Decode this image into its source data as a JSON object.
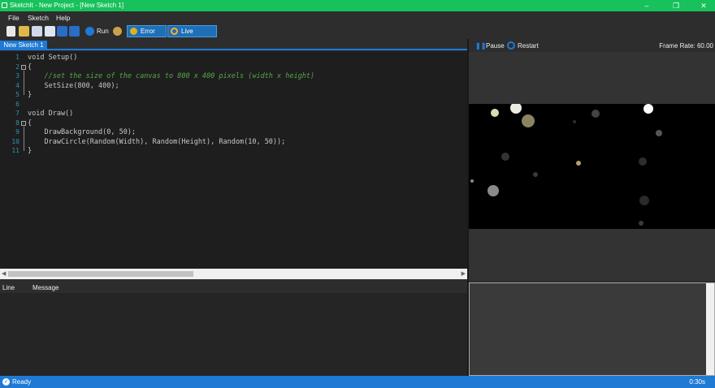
{
  "window": {
    "title": "SketchIt - New Project - [New Sketch 1]",
    "minimize": "–",
    "maximize": "❐",
    "close": "✕"
  },
  "menu": {
    "file": "File",
    "sketch": "Sketch",
    "help": "Help"
  },
  "toolbar": {
    "run": "Run",
    "error_list": "Error List",
    "live_preview": "Live Preview"
  },
  "tabs": [
    {
      "label": "New Sketch 1"
    }
  ],
  "code_lines": [
    {
      "num": "1",
      "text": "void Setup()"
    },
    {
      "num": "2",
      "text": "{"
    },
    {
      "num": "3",
      "text": "    //set the size of the canvas to 800 x 400 pixels (width x height)",
      "comment": true
    },
    {
      "num": "4",
      "text": "    SetSize(800, 400);"
    },
    {
      "num": "5",
      "text": "}"
    },
    {
      "num": "6",
      "text": ""
    },
    {
      "num": "7",
      "text": "void Draw()"
    },
    {
      "num": "8",
      "text": "{"
    },
    {
      "num": "9",
      "text": "    DrawBackground(0, 50);"
    },
    {
      "num": "10",
      "text": "    DrawCircle(Random(Width), Random(Height), Random(10, 50));"
    },
    {
      "num": "11",
      "text": "}"
    }
  ],
  "error_list": {
    "col_line": "Line",
    "col_message": "Message"
  },
  "preview": {
    "pause": "Pause",
    "restart": "Restart",
    "frame_rate": "Frame Rate: 60.00"
  },
  "status": {
    "text": "Ready",
    "time": "0:30s"
  },
  "colors": {
    "accent": "#1e7ad4",
    "titlebar": "#17c15b",
    "comment": "#57a64a",
    "line_number": "#2b91af"
  }
}
